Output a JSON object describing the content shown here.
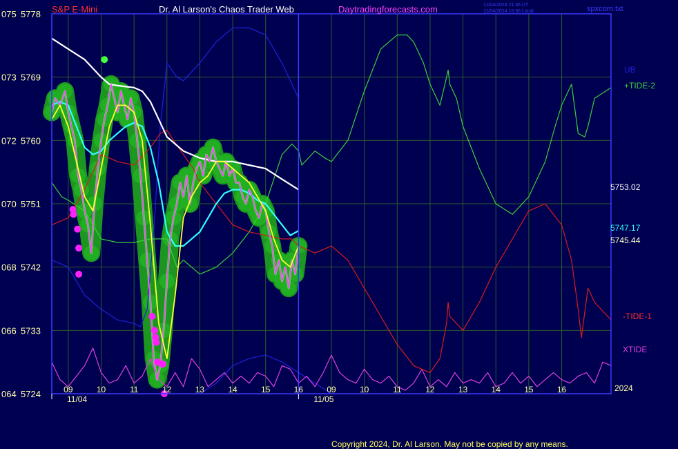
{
  "header": {
    "symbol": "S&P E-Mini",
    "title": "Dr. Al Larson's Chaos Trader Web",
    "site": "Daytradingforecasts.com",
    "time_utc": "11/04/2024 21:36 UT",
    "time_local": "11/04/2024 16:36 Local",
    "file": "spxcom.txt"
  },
  "copyright": "Copyright 2024, Dr. Al Larson. May not be copied by any means.",
  "year_label": "2024",
  "colors": {
    "background": "#000050",
    "frame": "#3a3aff",
    "grid": "#2c5a2c",
    "price": "#ff40ff",
    "price_band": "#1f9e1f",
    "yellow_ma": "#ffff30",
    "cyan_ma": "#30ffff",
    "white_ma": "#ffffff",
    "tide_plus": "#3ad13a",
    "tide_minus": "#d81c1c",
    "xtide": "#e040e0",
    "ub": "#2020dd",
    "symbol": "#ff3030",
    "title": "#ffffff",
    "site": "#ff40ff"
  },
  "chart_data": {
    "type": "line",
    "title": "",
    "xlabel": "",
    "ylabel": "",
    "y_axis": {
      "ticks": [
        {
          "left": "075",
          "right": "5778"
        },
        {
          "left": "073",
          "right": "5769"
        },
        {
          "left": "072",
          "right": "5760"
        },
        {
          "left": "070",
          "right": "5751"
        },
        {
          "left": "068",
          "right": "5742"
        },
        {
          "left": "066",
          "right": "5733"
        },
        {
          "left": "064",
          "right": "5724"
        }
      ],
      "ylim": [
        5724,
        5778
      ]
    },
    "x_axis": {
      "day1_date": "11/04",
      "day2_date": "11/05",
      "day1_hours": [
        "09",
        "10",
        "11",
        "12",
        "13",
        "14",
        "15",
        "16"
      ],
      "day2_hours": [
        "09",
        "10",
        "11",
        "12",
        "13",
        "14",
        "15",
        "16"
      ],
      "xlim": [
        8.5,
        25.5
      ]
    },
    "grid": true,
    "right_labels": {
      "ub": "UB",
      "tide_plus": "+TIDE-2",
      "tide_minus": "-TIDE-1",
      "xtide": "XTIDE",
      "white_value": "5753.02",
      "cyan_value": "5747.17",
      "yellow_value": "5745.44"
    },
    "series": [
      {
        "key": "price",
        "x": [
          8.5,
          8.6,
          8.75,
          8.9,
          9.0,
          9.1,
          9.2,
          9.3,
          9.4,
          9.5,
          9.6,
          9.7,
          9.8,
          9.9,
          10.0,
          10.1,
          10.2,
          10.3,
          10.4,
          10.5,
          10.6,
          10.7,
          10.8,
          10.9,
          11.0,
          11.1,
          11.2,
          11.3,
          11.4,
          11.5,
          11.6,
          11.7,
          11.8,
          11.9,
          12.0,
          12.1,
          12.2,
          12.3,
          12.4,
          12.5,
          12.6,
          12.7,
          12.8,
          12.9,
          13.0,
          13.1,
          13.2,
          13.3,
          13.4,
          13.5,
          13.6,
          13.7,
          13.8,
          13.9,
          14.0,
          14.1,
          14.2,
          14.3,
          14.4,
          14.5,
          14.6,
          14.7,
          14.8,
          14.9,
          15.0,
          15.1,
          15.2,
          15.3,
          15.4,
          15.5,
          15.6,
          15.7,
          15.8,
          15.9,
          16.0
        ],
        "y": [
          5764,
          5766,
          5765,
          5767,
          5764,
          5762,
          5760,
          5755,
          5753,
          5750,
          5748,
          5744,
          5751,
          5756,
          5760,
          5763,
          5765,
          5768,
          5766,
          5764,
          5767,
          5765,
          5763,
          5766,
          5764,
          5760,
          5755,
          5749,
          5743,
          5737,
          5729,
          5726,
          5728,
          5733,
          5740,
          5746,
          5749,
          5751,
          5754,
          5752,
          5755,
          5751,
          5754,
          5756,
          5757,
          5755,
          5758,
          5757,
          5759,
          5757,
          5756,
          5755,
          5757,
          5755,
          5756,
          5754,
          5754,
          5752,
          5751,
          5753,
          5752,
          5750,
          5749,
          5751,
          5750,
          5747,
          5745,
          5741,
          5743,
          5740,
          5742,
          5739,
          5743,
          5741,
          5745
        ]
      },
      {
        "key": "yellow",
        "x": [
          8.5,
          8.75,
          9.0,
          9.25,
          9.5,
          9.75,
          10.0,
          10.25,
          10.5,
          10.75,
          11.0,
          11.25,
          11.5,
          11.75,
          12.0,
          12.25,
          12.5,
          12.75,
          13.0,
          13.25,
          13.5,
          13.75,
          14.0,
          14.25,
          14.5,
          14.75,
          15.0,
          15.25,
          15.5,
          15.75,
          16.0
        ],
        "y": [
          5763,
          5765,
          5762,
          5757,
          5752,
          5750,
          5756,
          5762,
          5765,
          5765,
          5764,
          5760,
          5748,
          5734,
          5729,
          5738,
          5749,
          5752,
          5754,
          5755,
          5757,
          5757,
          5756,
          5755,
          5754,
          5752,
          5750,
          5746,
          5743,
          5742,
          5745
        ]
      },
      {
        "key": "cyan",
        "x": [
          8.5,
          8.75,
          9.0,
          9.25,
          9.5,
          9.75,
          10.0,
          10.25,
          10.5,
          10.75,
          11.0,
          11.25,
          11.5,
          11.75,
          12.0,
          12.25,
          12.5,
          12.75,
          13.0,
          13.25,
          13.5,
          13.75,
          14.0,
          14.25,
          14.5,
          14.75,
          15.0,
          15.25,
          15.5,
          15.75,
          16.0
        ],
        "y": [
          5765,
          5765.5,
          5765,
          5762,
          5759,
          5758,
          5758.5,
          5760,
          5761,
          5762,
          5762.5,
          5762,
          5759,
          5754,
          5747,
          5745,
          5745,
          5746,
          5747,
          5749,
          5751,
          5752.5,
          5753,
          5753,
          5752.5,
          5751.5,
          5751,
          5749.5,
          5748,
          5746.5,
          5747.17
        ]
      },
      {
        "key": "white",
        "x": [
          8.5,
          9.0,
          9.5,
          10.0,
          10.25,
          10.5,
          11.0,
          11.25,
          11.5,
          11.75,
          12.0,
          12.5,
          13.0,
          13.5,
          14.0,
          14.5,
          15.0,
          15.5,
          16.0
        ],
        "y": [
          5774.5,
          5773,
          5771.5,
          5769,
          5768,
          5767.8,
          5767.5,
          5767,
          5765.5,
          5763,
          5760.5,
          5758.5,
          5757.5,
          5757,
          5757,
          5756.5,
          5756,
          5754.5,
          5753
        ]
      },
      {
        "key": "tide_plus",
        "x": [
          8.5,
          8.8,
          9.0,
          9.5,
          10.0,
          10.5,
          11.0,
          11.5,
          12.0,
          12.3,
          12.5,
          13.0,
          13.5,
          14.0,
          14.5,
          15.0,
          15.5,
          15.8,
          16.0,
          16.1,
          16.2,
          16.5,
          16.8,
          17.0,
          17.5,
          18.0,
          18.5,
          19.0,
          19.3,
          19.5,
          19.8,
          20.0,
          20.3,
          20.5,
          20.55,
          20.6,
          20.8,
          21.0,
          21.5,
          22.0,
          22.5,
          23.0,
          23.5,
          23.8,
          24.0,
          24.3,
          24.5,
          24.7,
          24.8,
          25.0,
          25.5
        ],
        "y": [
          5754,
          5752,
          5751.5,
          5750,
          5746,
          5745.5,
          5745.5,
          5746,
          5746,
          5742,
          5743,
          5741,
          5742,
          5744,
          5747,
          5751,
          5758,
          5759.5,
          5758.5,
          5756.5,
          5757,
          5758.5,
          5757.5,
          5757,
          5760,
          5767,
          5773,
          5775,
          5775,
          5774,
          5771,
          5768,
          5765,
          5769,
          5770,
          5768,
          5766,
          5762,
          5756,
          5751,
          5749.5,
          5752,
          5757,
          5762,
          5765,
          5768,
          5761,
          5760.5,
          5762,
          5766,
          5767.5
        ]
      },
      {
        "key": "tide_minus",
        "x": [
          8.5,
          9.0,
          9.5,
          10.0,
          10.5,
          11.0,
          11.5,
          11.8,
          12.0,
          12.2,
          12.5,
          12.8,
          13.0,
          13.5,
          14.0,
          14.5,
          15.0,
          15.5,
          15.8,
          16.0,
          16.5,
          17.0,
          17.5,
          18.0,
          18.5,
          19.0,
          19.5,
          20.0,
          20.3,
          20.5,
          20.55,
          20.6,
          21.0,
          21.5,
          22.0,
          22.5,
          23.0,
          23.5,
          24.0,
          24.3,
          24.5,
          24.6,
          24.8,
          25.0,
          25.5
        ],
        "y": [
          5748,
          5749,
          5753,
          5758,
          5757,
          5756.5,
          5759,
          5761,
          5761.5,
          5760,
          5758,
          5756,
          5754,
          5751,
          5748,
          5747,
          5746.5,
          5746,
          5746,
          5745,
          5744,
          5745,
          5743,
          5739,
          5735,
          5731,
          5728,
          5727,
          5729,
          5734,
          5737,
          5735,
          5733,
          5737,
          5742,
          5746,
          5750,
          5751,
          5748,
          5743,
          5736,
          5732,
          5739,
          5737,
          5734.5
        ]
      },
      {
        "key": "ub",
        "x": [
          8.5,
          9.0,
          9.5,
          10.0,
          10.5,
          11.0,
          11.2,
          11.4,
          11.6,
          11.8,
          12.0,
          12.3,
          12.5,
          13.0,
          13.5,
          14.0,
          14.5,
          15.0,
          15.5,
          15.8,
          16.0
        ],
        "y": [
          5743,
          5742,
          5738,
          5736,
          5734.5,
          5734,
          5733.5,
          5736,
          5747,
          5762,
          5771,
          5769,
          5768.5,
          5771,
          5774,
          5776,
          5776,
          5775,
          5771,
          5768,
          5766
        ]
      },
      {
        "key": "lower_blue",
        "x": [
          13.0,
          13.5,
          14.0,
          14.5,
          15.0,
          15.5,
          16.0,
          16.5,
          17.0
        ],
        "y": [
          5724,
          5725.5,
          5728,
          5729,
          5729.5,
          5728.5,
          5727,
          5725.5,
          5724
        ]
      },
      {
        "key": "xtide",
        "x": [
          8.5,
          8.75,
          9.0,
          9.25,
          9.5,
          9.75,
          10.0,
          10.25,
          10.5,
          10.75,
          11.0,
          11.25,
          11.5,
          11.75,
          12.0,
          12.25,
          12.5,
          12.75,
          13.0,
          13.25,
          13.5,
          13.75,
          14.0,
          14.25,
          14.5,
          14.75,
          15.0,
          15.25,
          15.5,
          15.75,
          16.0,
          16.25,
          16.5,
          16.75,
          17.0,
          17.25,
          17.5,
          17.75,
          18.0,
          18.25,
          18.5,
          18.75,
          19.0,
          19.25,
          19.5,
          19.75,
          20.0,
          20.25,
          20.5,
          20.75,
          21.0,
          21.25,
          21.5,
          21.75,
          22.0,
          22.25,
          22.5,
          22.75,
          23.0,
          23.25,
          23.5,
          23.75,
          24.0,
          24.25,
          24.5,
          24.75,
          25.0,
          25.25,
          25.5
        ],
        "y": [
          5728.5,
          5726,
          5725,
          5726.5,
          5728,
          5730.5,
          5727,
          5725.5,
          5726,
          5728,
          5725.5,
          5726.5,
          5729,
          5726,
          5725,
          5727,
          5725,
          5729,
          5727.5,
          5725,
          5726,
          5727,
          5725.5,
          5726.5,
          5725.5,
          5727,
          5726.5,
          5725,
          5728,
          5727.5,
          5725.5,
          5726.5,
          5725,
          5727,
          5729.5,
          5727,
          5726,
          5725.5,
          5727.5,
          5726,
          5725.5,
          5726.5,
          5725,
          5724.5,
          5725.5,
          5727.5,
          5725,
          5726,
          5725,
          5727,
          5725.5,
          5726,
          5725.5,
          5727,
          5725,
          5725.5,
          5727,
          5725.5,
          5726.5,
          5725,
          5726,
          5727,
          5726,
          5725.5,
          5726.5,
          5727,
          5725.5,
          5728.5,
          5728
        ]
      }
    ],
    "markers": {
      "top_green": {
        "x": 10.1,
        "y": 5771.5
      },
      "magenta": [
        {
          "x": 9.14,
          "y": 5750.2
        },
        {
          "x": 9.16,
          "y": 5749.5
        },
        {
          "x": 9.28,
          "y": 5747.4
        },
        {
          "x": 9.32,
          "y": 5744.7
        },
        {
          "x": 9.32,
          "y": 5741
        },
        {
          "x": 11.55,
          "y": 5735
        },
        {
          "x": 11.62,
          "y": 5733
        },
        {
          "x": 11.66,
          "y": 5732
        },
        {
          "x": 11.68,
          "y": 5731.3
        },
        {
          "x": 11.72,
          "y": 5728.5
        },
        {
          "x": 11.82,
          "y": 5728.3
        },
        {
          "x": 11.88,
          "y": 5728.2
        },
        {
          "x": 11.92,
          "y": 5724
        }
      ]
    }
  }
}
